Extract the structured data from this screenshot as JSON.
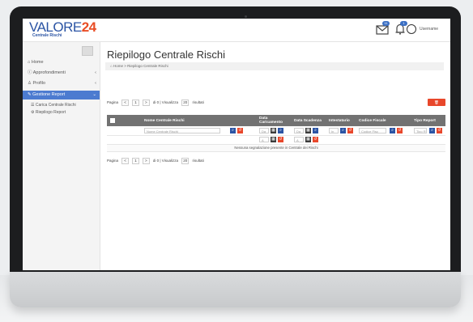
{
  "app": {
    "logo_text": "VALORE",
    "logo_number": "24",
    "logo_subtitle": "Centrale Rischi",
    "notifications_badge": "11",
    "alerts_badge": "1",
    "username": "Username"
  },
  "sidebar": {
    "items": [
      {
        "label": "Home",
        "icon": "home-icon"
      },
      {
        "label": "Approfondimenti",
        "icon": "info-icon"
      },
      {
        "label": "Profilo",
        "icon": "user-icon"
      },
      {
        "label": "Gestione Report",
        "icon": "edit-icon"
      }
    ],
    "subitems": [
      {
        "label": "Carica Centrale Rischi"
      },
      {
        "label": "Riepilogo Report"
      }
    ]
  },
  "main": {
    "title": "Riepilogo Centrale Rischi",
    "breadcrumb": "Home > Riepilogo Centrale Rischi",
    "pager": {
      "label": "Pagina",
      "prev": "<",
      "page": "1",
      "next": ">",
      "of_text": "di 0 | Visualizza",
      "page_size": "20",
      "results_text": "risultati"
    },
    "cancella_label": "Cancella",
    "columns": [
      "Nome Centrale Rischi",
      "Data Caricamento",
      "Data Scadenza",
      "Intestatario",
      "Codice Fiscale",
      "Tipo Report"
    ],
    "filters": {
      "nome_placeholder": "Nome Centrale Rischi",
      "da_label": "Da",
      "a_label": "A",
      "intestatario_placeholder": "In",
      "codice_placeholder": "Codice Fisc",
      "tipo_placeholder": "Tipo R"
    },
    "empty_message": "Nessuna segnalazione presente in Centrale dei Rischi"
  },
  "colors": {
    "brand_blue": "#2b54a4",
    "brand_orange": "#e94d25",
    "sidebar_active": "#4c7bd0",
    "danger": "#e8472b",
    "header_grey": "#727272"
  }
}
